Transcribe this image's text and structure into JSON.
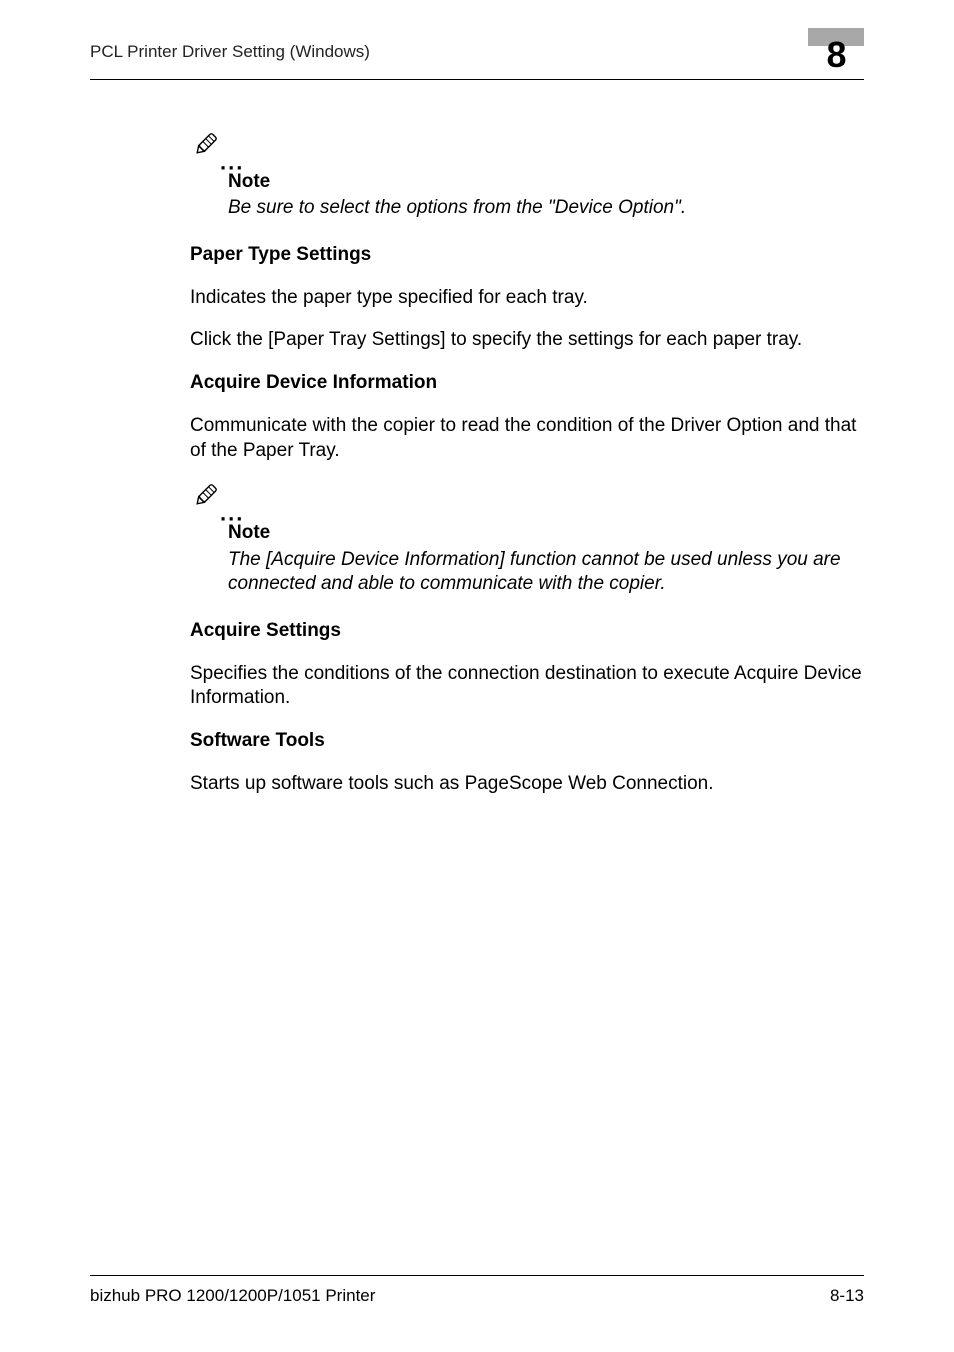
{
  "header": {
    "title": "PCL Printer Driver Setting (Windows)",
    "chapter": "8"
  },
  "note1": {
    "heading": "Note",
    "body": "Be sure to select the options from the \"Device Option\"."
  },
  "s1": {
    "heading": "Paper Type Settings",
    "p1": "Indicates the paper type specified for each tray.",
    "p2": "Click the [Paper Tray Settings] to specify the settings for each paper tray."
  },
  "s2": {
    "heading": "Acquire Device Information",
    "p1": "Communicate with the copier to read the condition of the Driver Option and that of the Paper Tray."
  },
  "note2": {
    "heading": "Note",
    "body": "The [Acquire Device Information] function cannot be used unless you are connected and able to communicate with the copier."
  },
  "s3": {
    "heading": "Acquire Settings",
    "p1": "Specifies the conditions of the connection destination to execute Acquire Device Information."
  },
  "s4": {
    "heading": "Software Tools",
    "p1": "Starts up software tools such as PageScope Web Connection."
  },
  "footer": {
    "product": "bizhub PRO 1200/1200P/1051 Printer",
    "page": "8-13"
  }
}
